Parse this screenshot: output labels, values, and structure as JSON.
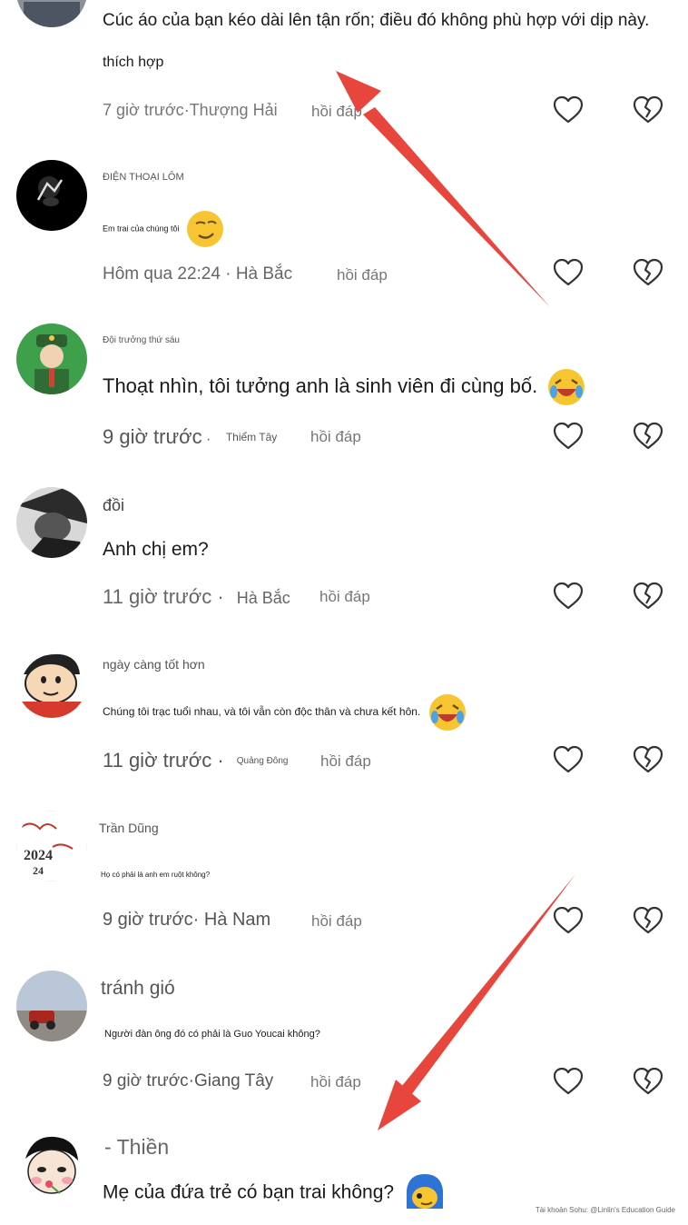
{
  "comments": [
    {
      "username": "",
      "text": "Cúc áo của bạn kéo dài lên tận rốn; điều đó không phù hợp với dịp này.",
      "subtext": "thích hợp",
      "time": "7 giờ trước",
      "separator": "·",
      "location": "Thượng Hải",
      "reply_label": "hồi đáp"
    },
    {
      "username": "ĐIỆN THOẠI LÔM",
      "text": "Em trai của chúng tôi",
      "time": "Hôm qua 22:24",
      "separator": " · ",
      "location": "Hà Bắc",
      "reply_label": "hồi đáp"
    },
    {
      "username": "Đội trưởng thứ sáu",
      "text": "Thoạt nhìn, tôi tưởng anh là sinh viên đi cùng bố.",
      "time": "9 giờ trước",
      "separator": " · ",
      "location": "Thiểm Tây",
      "reply_label": "hồi đáp"
    },
    {
      "username": "đồi",
      "text": "Anh chị em?",
      "time": "11 giờ trước",
      "separator": " · ",
      "location": "Hà Bắc",
      "reply_label": "hồi đáp"
    },
    {
      "username": "ngày càng tốt hơn",
      "text": "Chúng tôi trạc tuổi nhau, và tôi vẫn còn độc thân và chưa kết hôn.",
      "time": "11 giờ trước",
      "separator": " · ",
      "location": "Quảng Đông",
      "reply_label": "hồi đáp"
    },
    {
      "username": "Trần Dũng",
      "text": "Họ có phải là anh em ruột không?",
      "time": "9 giờ trước",
      "separator": "· ",
      "location": "Hà Nam",
      "reply_label": "hồi đáp"
    },
    {
      "username": "tránh gió",
      "text": "Người đàn ông đó có phải là Guo Youcai không?",
      "time": "9 giờ trước",
      "separator": "·",
      "location": "Giang Tây",
      "reply_label": "hồi đáp"
    },
    {
      "username": "- Thiền",
      "text": "Mẹ của đứa trẻ có bạn trai không?"
    }
  ],
  "avatar_texts": {
    "tran_dung_top": "2024",
    "tran_dung_bottom": "24"
  },
  "watermark": "Tài khoản Sohu: @Linlin's Education Guide",
  "icons": {
    "like": "heart-outline-icon",
    "dislike": "broken-heart-icon"
  },
  "colors": {
    "arrow": "#e8453c",
    "text": "#1a1a1a",
    "meta": "#777777",
    "icon": "#333333"
  }
}
